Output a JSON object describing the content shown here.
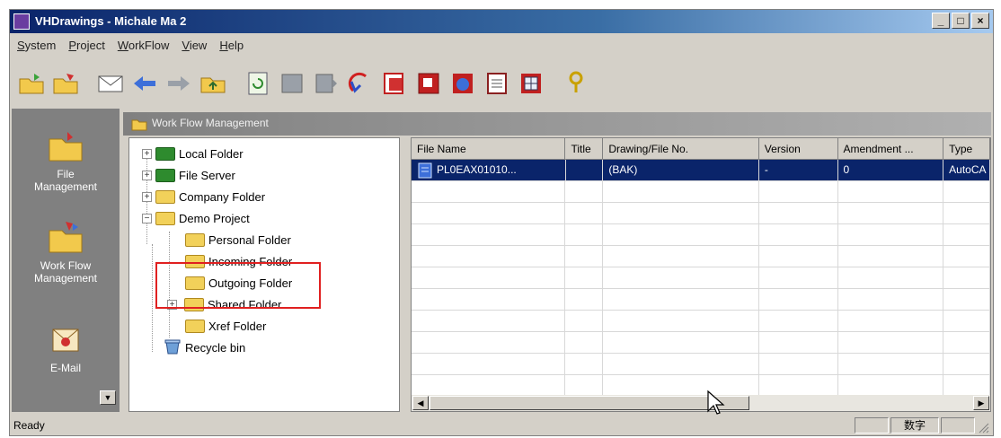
{
  "window": {
    "title": "VHDrawings - Michale Ma 2",
    "controls": [
      "_",
      "□",
      "×"
    ]
  },
  "menu": [
    {
      "first": "S",
      "rest": "ystem"
    },
    {
      "first": "P",
      "rest": "roject"
    },
    {
      "first": "W",
      "rest": "orkFlow"
    },
    {
      "first": "V",
      "rest": "iew"
    },
    {
      "first": "H",
      "rest": "elp"
    }
  ],
  "toolbar": [
    "open-folder-icon",
    "open-folder-alt-icon",
    "envelope-icon",
    "back-arrow-icon",
    "forward-arrow-icon",
    "up-folder-icon",
    "refresh-doc-icon",
    "checkout-icon",
    "checkin-icon",
    "undo-checkout-icon",
    "red-doc-icon",
    "red-stamp-icon",
    "blue-doc-icon",
    "notepad-icon",
    "grid-icon",
    "help-icon"
  ],
  "nav": {
    "items": [
      {
        "label_line1": "File",
        "label_line2": "Management"
      },
      {
        "label_line1": "Work Flow",
        "label_line2": "Management"
      },
      {
        "label_line1": "E-Mail",
        "label_line2": ""
      }
    ]
  },
  "workflow": {
    "title": "Work Flow Management"
  },
  "tree": {
    "local": "Local Folder",
    "fileserver": "File Server",
    "company": "Company Folder",
    "demo": "Demo Project",
    "personal": "Personal Folder",
    "incoming": "Incoming Folder",
    "outgoing": "Outgoing Folder",
    "shared": "Shared Folder",
    "xref": "Xref Folder",
    "recycle": "Recycle bin"
  },
  "list": {
    "columns": [
      "File Name",
      "Title",
      "Drawing/File No.",
      "Version",
      "Amendment ...",
      "Type"
    ],
    "rows": [
      [
        "PL0EAX01010...",
        "",
        "(BAK)",
        "-",
        "0",
        "AutoCA"
      ]
    ]
  },
  "status": {
    "text": "Ready",
    "ime": "数字"
  }
}
